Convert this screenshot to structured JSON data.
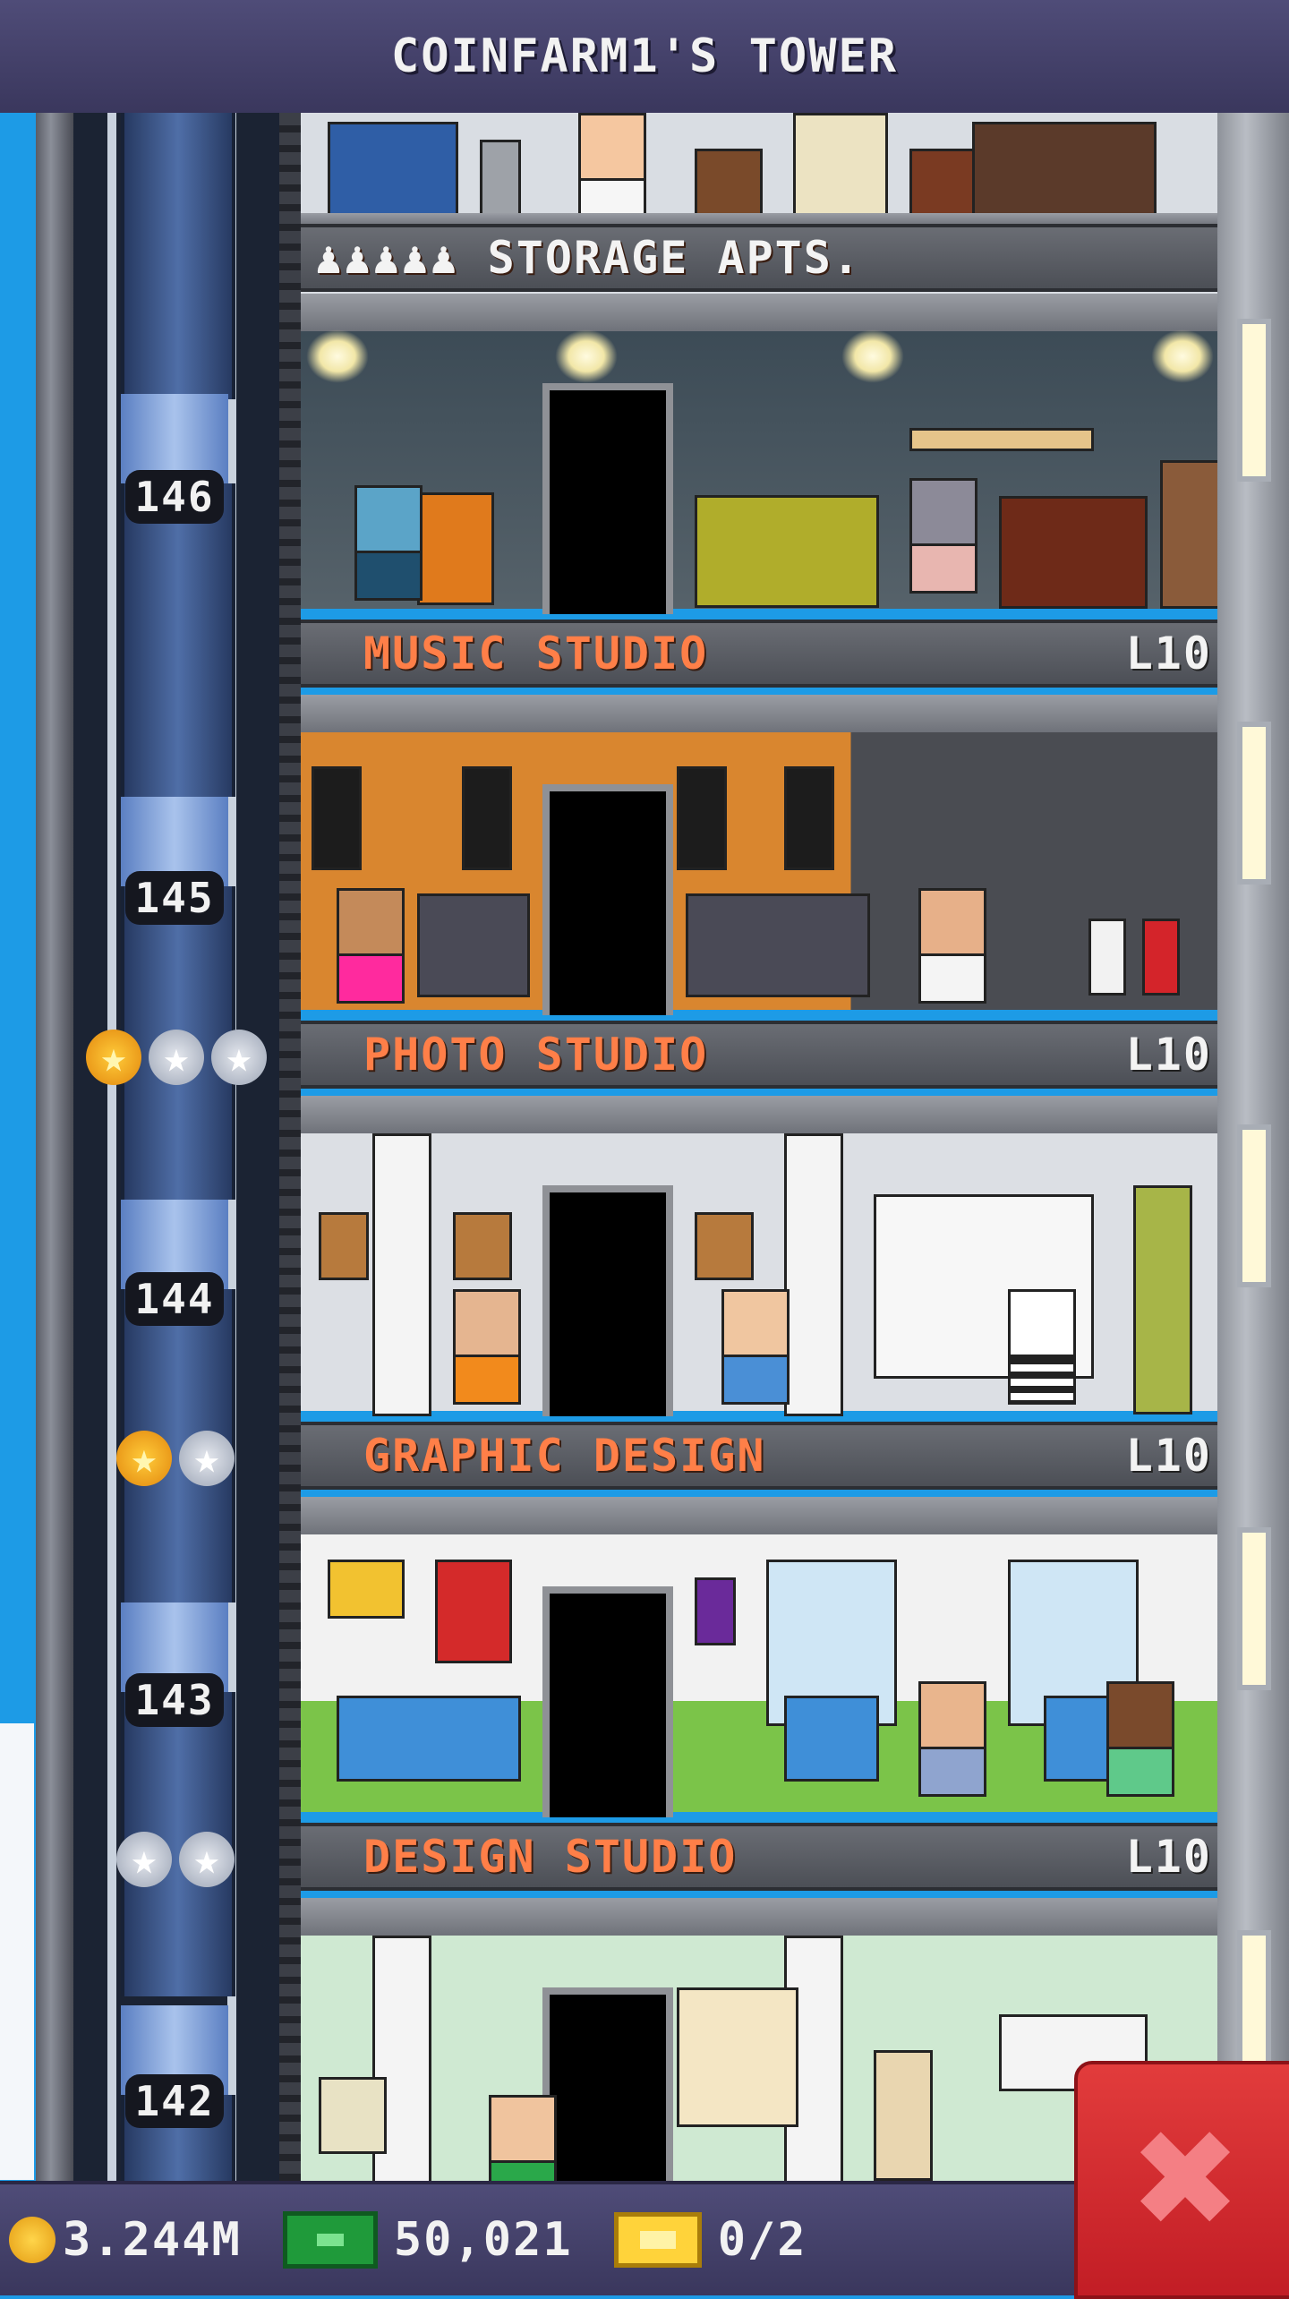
{
  "header": {
    "title": "COINFARM1'S TOWER"
  },
  "floors": [
    {
      "number": "",
      "name": "STORAGE APTS.",
      "level": "",
      "type": "residential",
      "residents_icon": "person-icons"
    },
    {
      "number": "146",
      "name": "MUSIC STUDIO",
      "level": "L10",
      "stars": []
    },
    {
      "number": "145",
      "name": "PHOTO STUDIO",
      "level": "L10",
      "stars": [
        "gold",
        "silver",
        "silver"
      ]
    },
    {
      "number": "144",
      "name": "GRAPHIC DESIGN",
      "level": "L10",
      "stars": [
        "gold",
        "silver"
      ]
    },
    {
      "number": "143",
      "name": "DESIGN STUDIO",
      "level": "L10",
      "stars": [
        "silver",
        "silver"
      ]
    },
    {
      "number": "142",
      "name": "",
      "level": ""
    }
  ],
  "resources": {
    "coins": "3.244M",
    "bux": "50,021",
    "vip": "0/2"
  },
  "icons": {
    "coins": "coin-icon",
    "bux": "tower-bux-icon",
    "vip": "vip-ticket-icon",
    "close": "close-icon",
    "star_gold": "gold-star-icon",
    "star_silver": "silver-star-icon"
  },
  "glyphs": {
    "star": "★",
    "close": "✖",
    "person": "♟"
  },
  "colors": {
    "header_bg": "#4a4773",
    "label_text": "#ff7f48",
    "level_text": "#f3f3f3",
    "close_button": "#d42a30",
    "sky": "#1d9be6"
  }
}
